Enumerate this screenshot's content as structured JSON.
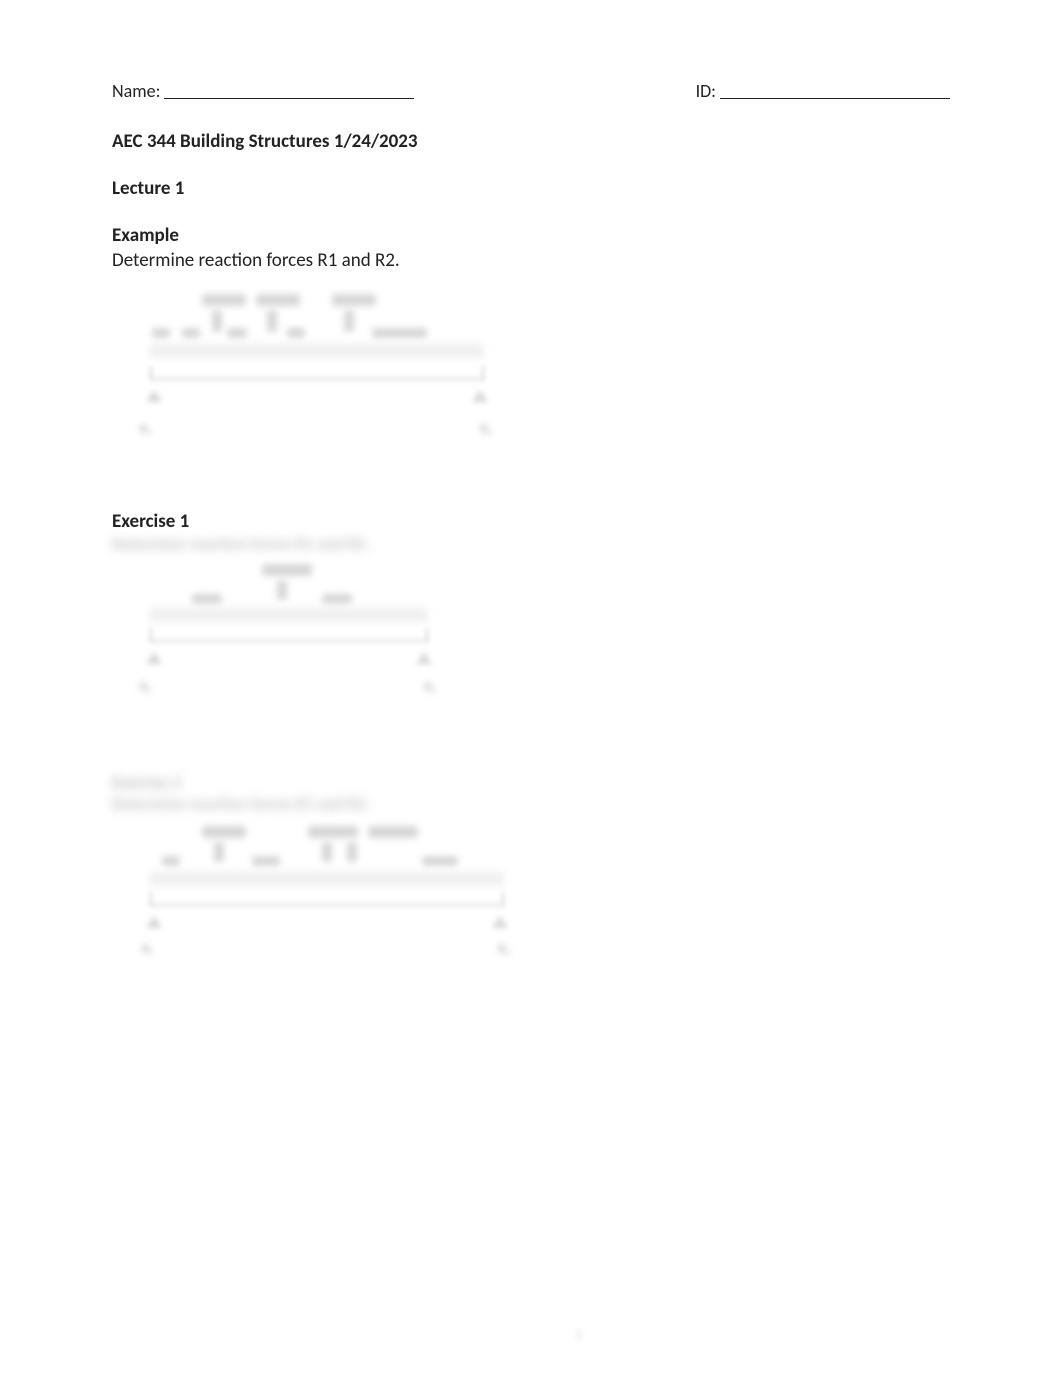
{
  "header": {
    "name_label": "Name:",
    "id_label": "ID:"
  },
  "course_title": "AEC 344 Building Structures 1/24/2023",
  "lecture": "Lecture 1",
  "example": {
    "heading": "Example",
    "instruction": "Determine reaction forces R1 and R2."
  },
  "exercise1": {
    "heading": "Exercise 1",
    "instruction_blurred": "Determine reaction forces R1 and R2."
  },
  "exercise2": {
    "heading_blurred": "Exercise 2",
    "instruction_blurred": "Determine reaction forces R1 and R2."
  },
  "diagram_generic": {
    "r1": "R₁",
    "r2": "R₂"
  },
  "page_number": "1"
}
